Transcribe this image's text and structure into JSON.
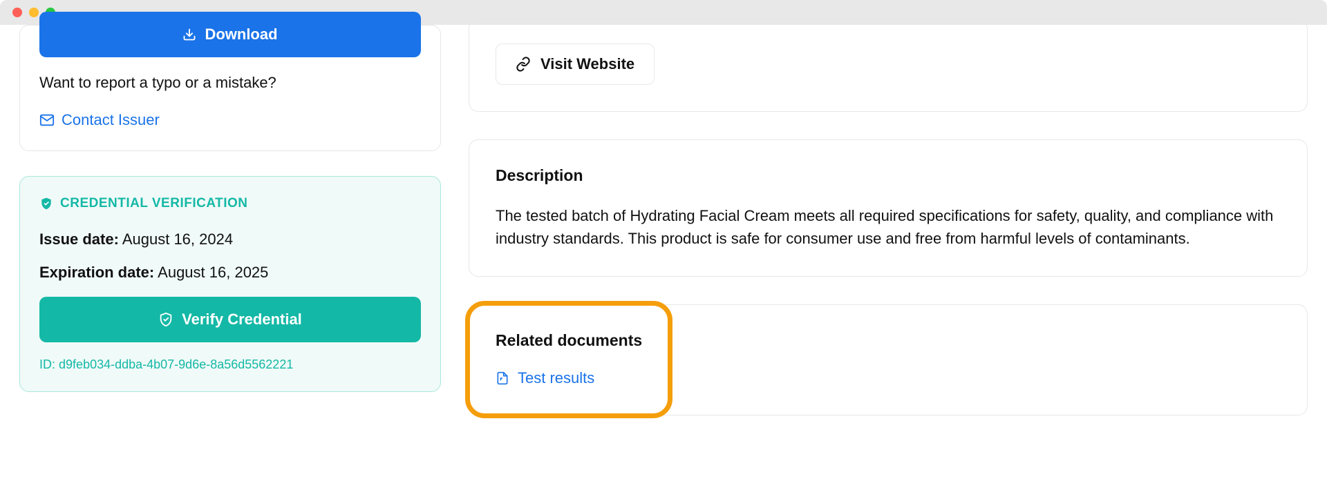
{
  "left": {
    "download_label": "Download",
    "report_text": "Want to report a typo or a mistake?",
    "contact_label": "Contact Issuer"
  },
  "verification": {
    "header": "CREDENTIAL VERIFICATION",
    "issue_label": "Issue date:",
    "issue_value": "August 16, 2024",
    "exp_label": "Expiration date:",
    "exp_value": "August 16, 2025",
    "verify_label": "Verify Credential",
    "id_label": "ID:",
    "id_value": "d9feb034-ddba-4b07-9d6e-8a56d5562221"
  },
  "right": {
    "visit_label": "Visit Website",
    "desc_heading": "Description",
    "desc_text": "The tested batch of Hydrating Facial Cream meets all required specifications for safety, quality, and compliance with industry standards. This product is safe for consumer use and free from harmful levels of contaminants.",
    "related_heading": "Related documents",
    "test_results_label": "Test results"
  }
}
